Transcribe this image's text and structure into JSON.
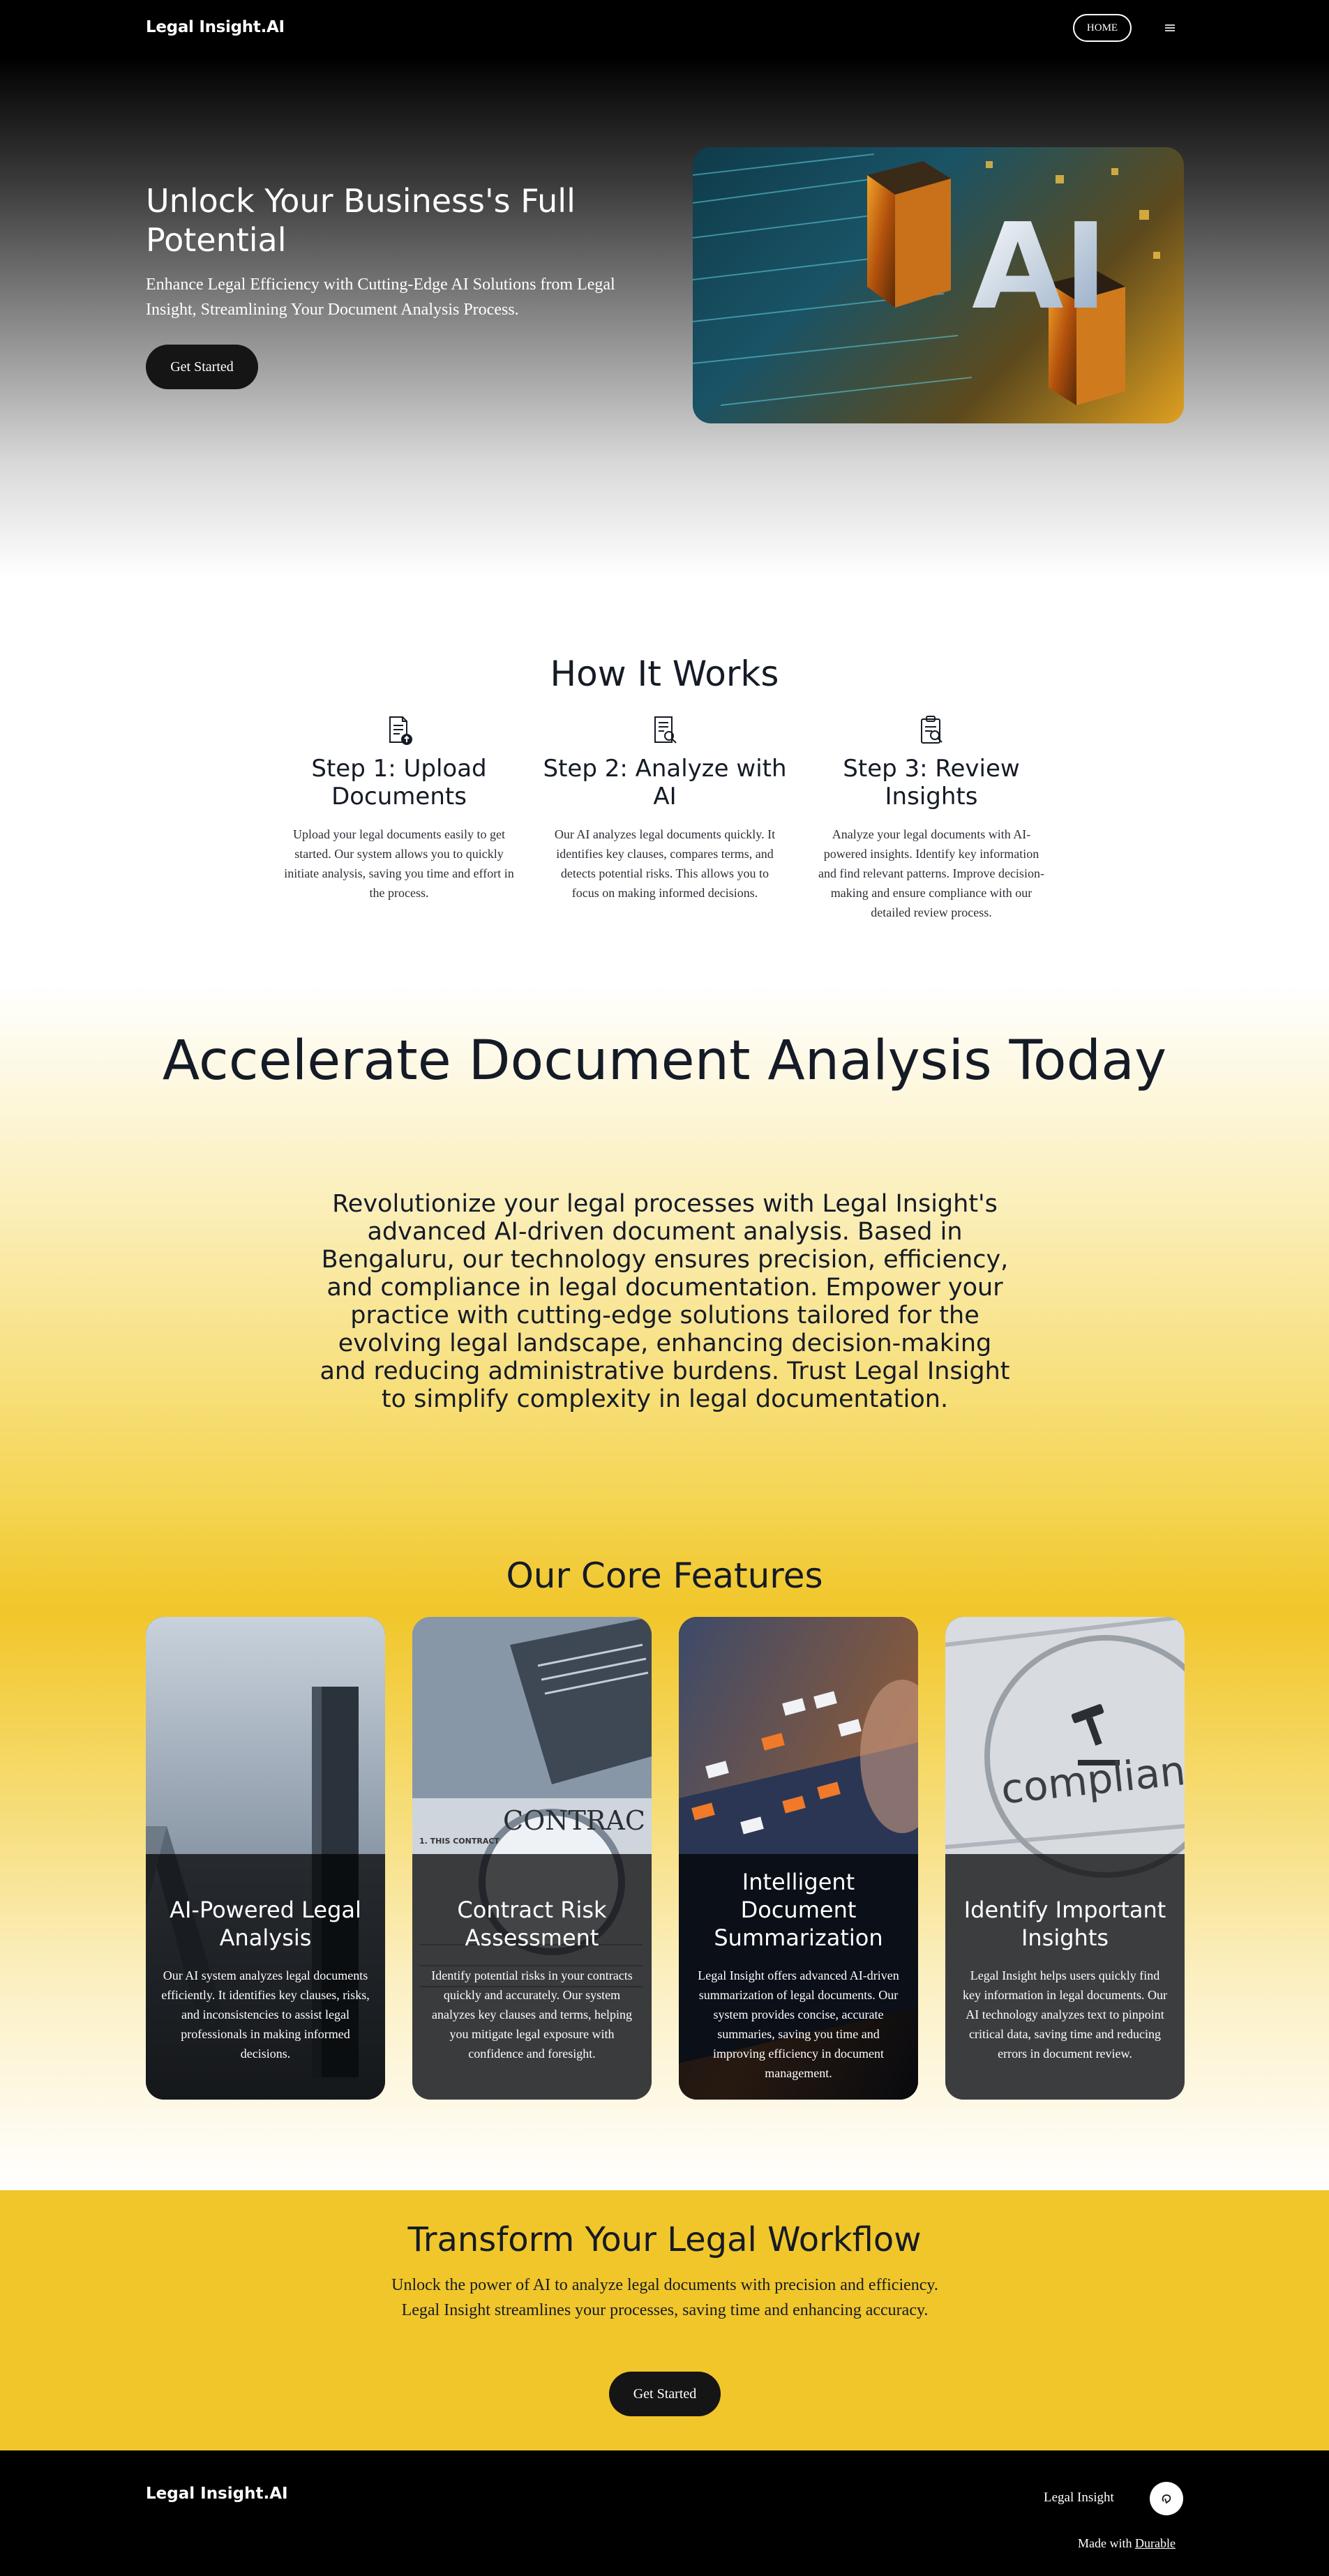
{
  "nav": {
    "logo": "Legal Insight.AI",
    "home_label": "HOME",
    "menu_icon": "hamburger-icon"
  },
  "hero": {
    "title": "Unlock Your Business's Full Potential",
    "subtitle": "Enhance Legal Efficiency with Cutting-Edge AI Solutions from Legal Insight, Streamlining Your Document Analysis Process.",
    "button_label": "Get Started"
  },
  "how": {
    "title": "How It Works",
    "steps": [
      {
        "icon": "document-upload-icon",
        "title": "Step 1: Upload Documents",
        "body": "Upload your legal documents easily to get started. Our system allows you to quickly initiate analysis, saving you time and effort in the process."
      },
      {
        "icon": "document-search-icon",
        "title": "Step 2: Analyze with AI",
        "body": "Our AI analyzes legal documents quickly. It identifies key clauses, compares terms, and detects potential risks. This allows you to focus on making informed decisions."
      },
      {
        "icon": "clipboard-review-icon",
        "title": "Step 3: Review Insights",
        "body": "Analyze your legal documents with AI-powered insights. Identify key information and find relevant patterns. Improve decision-making and ensure compliance with our detailed review process."
      }
    ]
  },
  "accelerate": {
    "title": "Accelerate Document Analysis Today",
    "body": "Revolutionize your legal processes with Legal Insight's advanced AI-driven document analysis. Based in Bengaluru, our technology ensures precision, efficiency, and compliance in legal documentation. Empower your practice with cutting-edge solutions tailored for the evolving legal landscape, enhancing decision-making and reducing administrative burdens. Trust Legal Insight to simplify complexity in legal documentation."
  },
  "features": {
    "title": "Our Core Features",
    "cards": [
      {
        "title": "AI-Powered Legal Analysis",
        "body": "Our AI system analyzes legal documents efficiently. It identifies key clauses, risks, and inconsistencies to assist legal professionals in making informed decisions.",
        "image_text": "AI"
      },
      {
        "title": "Contract Risk Assessment",
        "body": "Identify potential risks in your contracts quickly and accurately. Our system analyzes key clauses and terms, helping you mitigate legal exposure with confidence and foresight.",
        "image_text": "CONTRAC",
        "image_subtext": "1. THIS CONTRACT"
      },
      {
        "title": "Intelligent Document Summarization",
        "body": "Legal Insight offers advanced AI-driven summarization of legal documents. Our system provides concise, accurate summaries, saving you time and improving efficiency in document management.",
        "image_text": ""
      },
      {
        "title": "Identify Important Insights",
        "body": "Legal Insight helps users quickly find key information in legal documents. Our AI technology analyzes text to pinpoint critical data, saving time and reducing errors in document review.",
        "image_text": "complianc"
      }
    ]
  },
  "cta": {
    "title": "Transform Your Legal Workflow",
    "body": "Unlock the power of AI to analyze legal documents with precision and efficiency. Legal Insight streamlines your processes, saving time and enhancing accuracy.",
    "button_label": "Get Started"
  },
  "footer": {
    "logo": "Legal Insight.AI",
    "company": "Legal Insight",
    "made_with_prefix": "Made with",
    "made_with_link": "Durable",
    "social_icon": "social-icon"
  },
  "colors": {
    "accent_yellow": "#f1c62a",
    "dark": "#151515",
    "text": "#151b26"
  }
}
